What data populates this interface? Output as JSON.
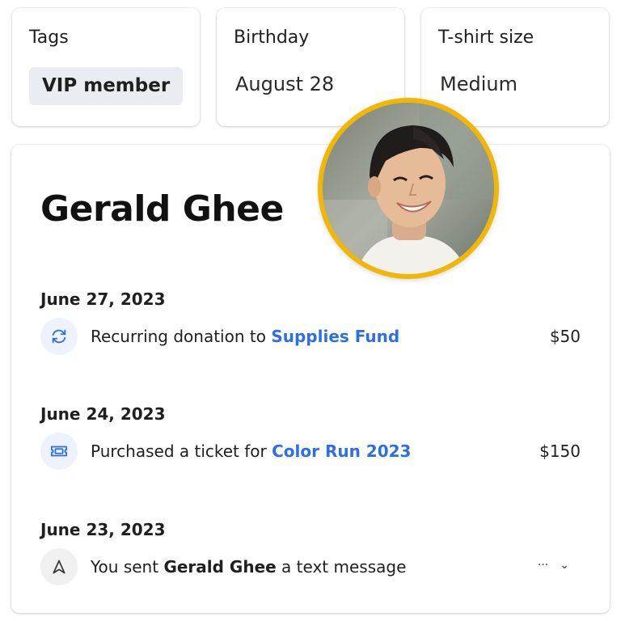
{
  "tags_card": {
    "label": "Tags",
    "chip": "VIP member"
  },
  "birthday_card": {
    "label": "Birthday",
    "value": "August 28"
  },
  "tshirt_card": {
    "label": "T-shirt size",
    "value": "Medium"
  },
  "profile": {
    "name": "Gerald Ghee",
    "avatar_ring_color": "#f2b705"
  },
  "activity": [
    {
      "date": "June 27, 2023",
      "icon": "recurring-icon",
      "text": "Recurring donation to ",
      "link": "Supplies Fund",
      "amount": "$50"
    },
    {
      "date": "June 24, 2023",
      "icon": "ticket-icon",
      "text": "Purchased a ticket for ",
      "link": "Color Run 2023",
      "amount": "$150"
    },
    {
      "date": "June 23, 2023",
      "icon": "send-icon",
      "text_before": "You sent ",
      "bold": "Gerald Ghee",
      "text_after": " a text message",
      "more": "···",
      "chevron": "⌄"
    }
  ],
  "colors": {
    "link": "#2f6fe4",
    "icon_bg_blue": "#eef2fd",
    "icon_bg_gray": "#f0f0f1"
  }
}
